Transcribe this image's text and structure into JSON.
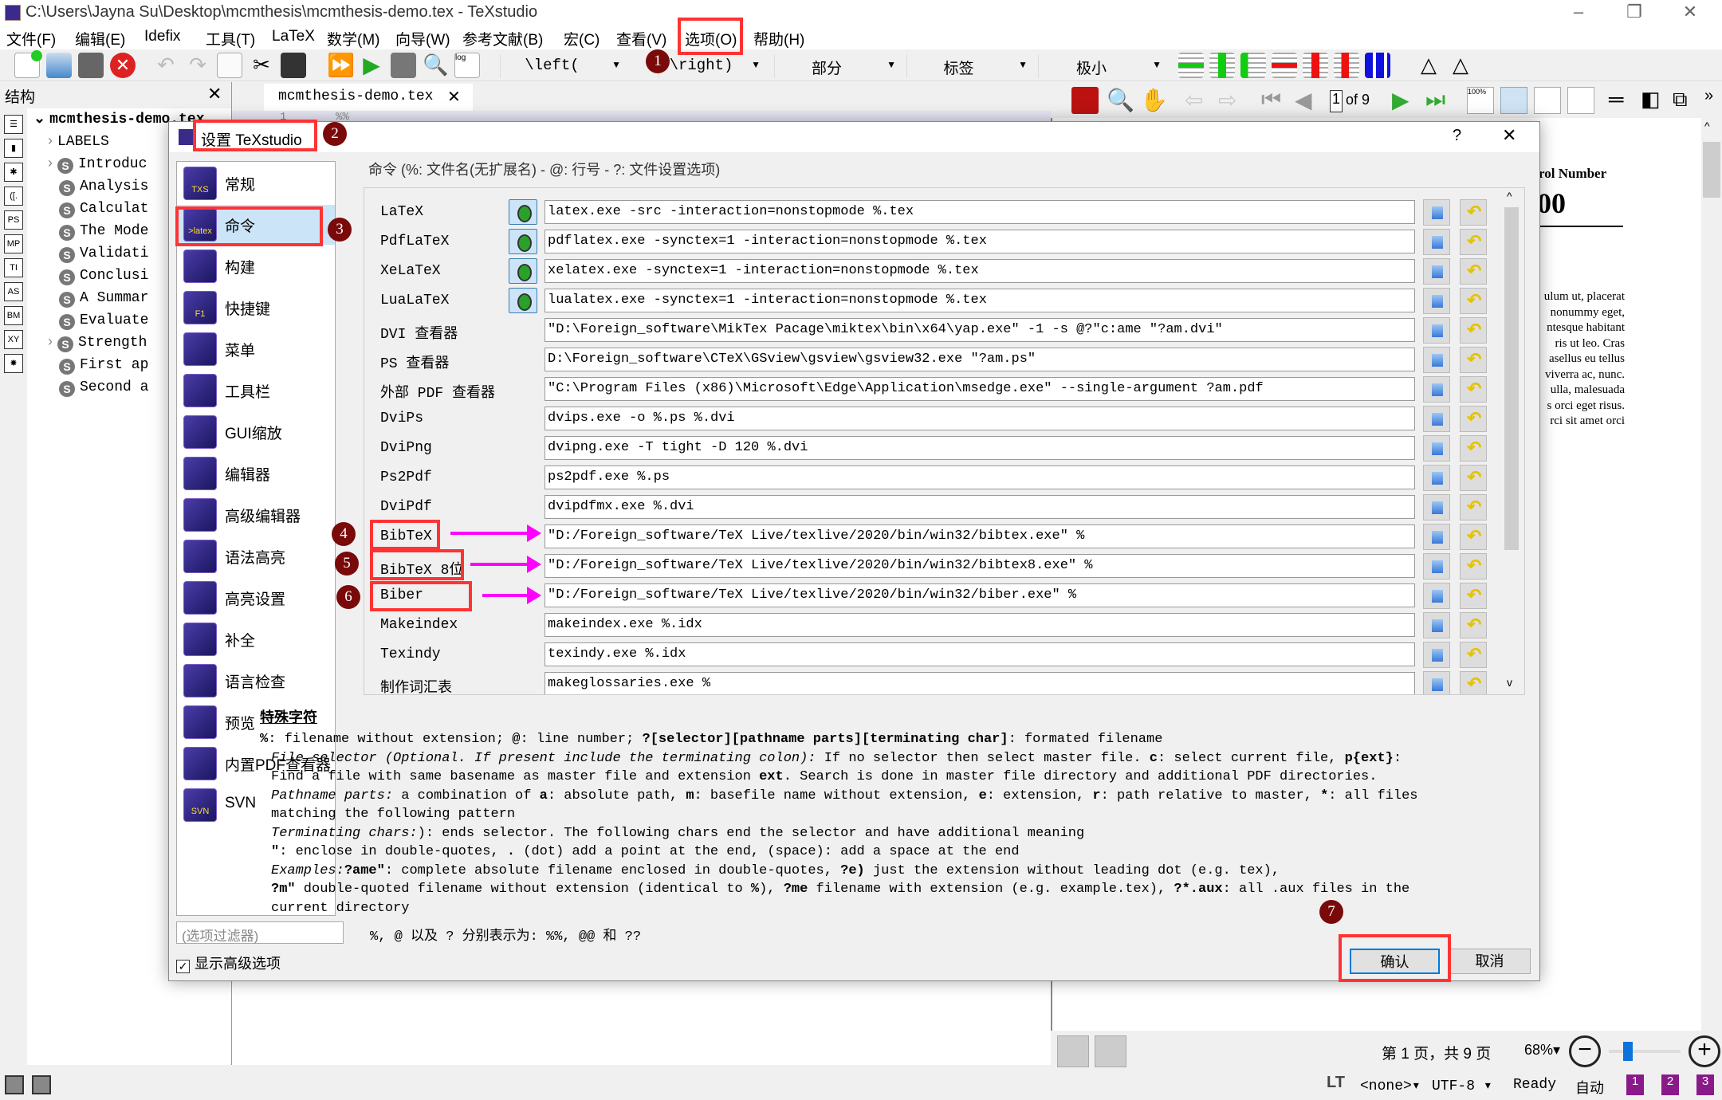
{
  "window": {
    "title": "C:\\Users\\Jayna Su\\Desktop\\mcmthesis\\mcmthesis-demo.tex - TeXstudio",
    "controls": [
      "–",
      "❐",
      "✕"
    ]
  },
  "menu": [
    "文件(F)",
    "编辑(E)",
    "Idefix",
    "工具(T)",
    "LaTeX",
    "数学(M)",
    "向导(W)",
    "参考文献(B)",
    "宏(C)",
    "查看(V)",
    "选项(O)",
    "帮助(H)"
  ],
  "toolbar": {
    "dropdowns": [
      "\\left(",
      "\\right)",
      "部分",
      "标签",
      "极小"
    ]
  },
  "structure": {
    "title": "结构",
    "root": "mcmthesis-demo.tex",
    "items": [
      {
        "label": "LABELS",
        "expandable": true,
        "badge": false
      },
      {
        "label": "Introduc",
        "expandable": true,
        "badge": true
      },
      {
        "label": "Analysis",
        "expandable": false,
        "badge": true
      },
      {
        "label": "Calculat",
        "expandable": false,
        "badge": true
      },
      {
        "label": "The Mode",
        "expandable": false,
        "badge": true
      },
      {
        "label": "Validati",
        "expandable": false,
        "badge": true
      },
      {
        "label": "Conclusi",
        "expandable": false,
        "badge": true
      },
      {
        "label": "A Summar",
        "expandable": false,
        "badge": true
      },
      {
        "label": "Evaluate",
        "expandable": false,
        "badge": true
      },
      {
        "label": "Strength",
        "expandable": true,
        "badge": true
      },
      {
        "label": "First ap",
        "expandable": false,
        "badge": true
      },
      {
        "label": "Second a",
        "expandable": false,
        "badge": true
      }
    ],
    "side_icons": [
      "☰",
      "▮",
      "✱",
      "([.",
      "PS",
      "MP",
      "TI",
      "AS",
      "BM",
      "XY",
      "✸"
    ]
  },
  "editor": {
    "tab": "mcmthesis-demo.tex",
    "line_number": "1",
    "line_text": "%%"
  },
  "pdf": {
    "page_input": "1",
    "page_of": "of 9",
    "heading": "rol Number",
    "big": "00",
    "body_lines": [
      "ulum ut, placerat",
      "nonummy eget,",
      "ntesque habitant",
      "ris ut leo.  Cras",
      "asellus eu tellus",
      "viverra ac, nunc.",
      "ulla, malesuada",
      "s orci eget risus.",
      "rci sit amet orci"
    ],
    "page_status": "第 1 页，共 9 页",
    "zoom": "68%",
    "zoom_slider": 0.2
  },
  "statusbar": {
    "lt": "LT",
    "language": "<none>",
    "encoding": "UTF-8",
    "status": "Ready",
    "auto": "自动",
    "bookmarks": [
      "1",
      "2",
      "3"
    ]
  },
  "dialog": {
    "title": "设置 TeXstudio",
    "help": "?",
    "close": "✕",
    "nav": [
      "常规",
      "命令",
      "构建",
      "快捷键",
      "菜单",
      "工具栏",
      "GUI缩放",
      "编辑器",
      "高级编辑器",
      "语法高亮",
      "高亮设置",
      "补全",
      "语言检查",
      "预览",
      "内置PDF查看器",
      "SVN"
    ],
    "nav_icon_text": [
      "TXS",
      ">latex",
      "",
      "F1",
      "",
      "",
      "",
      "",
      "",
      "",
      "",
      "",
      "",
      "",
      "",
      "SVN"
    ],
    "selected_nav": 1,
    "filter_placeholder": "(选项过滤器)",
    "advanced_label": "显示高级选项",
    "advanced_checked": true,
    "group_title": "命令 (%: 文件名(无扩展名) - @: 行号 - ?: 文件设置选项)",
    "commands": [
      {
        "label": "LaTeX",
        "value": "latex.exe -src -interaction=nonstopmode %.tex",
        "run": true
      },
      {
        "label": "PdfLaTeX",
        "value": "pdflatex.exe -synctex=1 -interaction=nonstopmode %.tex",
        "run": true
      },
      {
        "label": "XeLaTeX",
        "value": "xelatex.exe -synctex=1 -interaction=nonstopmode %.tex",
        "run": true
      },
      {
        "label": "LuaLaTeX",
        "value": "lualatex.exe -synctex=1 -interaction=nonstopmode %.tex",
        "run": true
      },
      {
        "label": "DVI 查看器",
        "value": "\"D:\\Foreign_software\\MikTex Pacage\\miktex\\bin\\x64\\yap.exe\" -1 -s @?\"c:ame \"?am.dvi\"",
        "run": false
      },
      {
        "label": "PS 查看器",
        "value": "D:\\Foreign_software\\CTeX\\GSview\\gsview\\gsview32.exe \"?am.ps\"",
        "run": false
      },
      {
        "label": "外部 PDF 查看器",
        "value": "\"C:\\Program Files (x86)\\Microsoft\\Edge\\Application\\msedge.exe\" --single-argument ?am.pdf",
        "run": false
      },
      {
        "label": "DviPs",
        "value": "dvips.exe -o %.ps %.dvi",
        "run": false
      },
      {
        "label": "DviPng",
        "value": "dvipng.exe -T tight -D 120 %.dvi",
        "run": false
      },
      {
        "label": "Ps2Pdf",
        "value": "ps2pdf.exe %.ps",
        "run": false
      },
      {
        "label": "DviPdf",
        "value": "dvipdfmx.exe %.dvi",
        "run": false
      },
      {
        "label": "BibTeX",
        "value": "\"D:/Foreign_software/TeX Live/texlive/2020/bin/win32/bibtex.exe\" %",
        "run": false
      },
      {
        "label": "BibTeX 8位",
        "value": "\"D:/Foreign_software/TeX Live/texlive/2020/bin/win32/bibtex8.exe\" %",
        "run": false
      },
      {
        "label": "Biber",
        "value": "\"D:/Foreign_software/TeX Live/texlive/2020/bin/win32/biber.exe\" %",
        "run": false
      },
      {
        "label": "Makeindex",
        "value": "makeindex.exe %.idx",
        "run": false
      },
      {
        "label": "Texindy",
        "value": "texindy.exe %.idx",
        "run": false
      },
      {
        "label": "制作词汇表",
        "value": "makeglossaries.exe %",
        "run": false
      }
    ],
    "special_title": "特殊字符",
    "help_lines": [
      "<b>%</b>: filename without extension; <b>@</b>: line number; <b>?[selector][pathname parts][terminating char]</b>: formated filename",
      "<i>File selector (Optional. If present include the terminating colon):</i> If no selector then select master file. <b>c</b>: select current file, <b>p{ext}</b>:",
      "Find a file with same basename as master file and extension <b>ext</b>. Search is done in master file directory and additional PDF directories.",
      "<i>Pathname parts:</i> a combination of <b>a</b>: absolute path, <b>m</b>: basefile name without extension, <b>e</b>: extension, <b>r</b>: path relative to master, <b>*</b>: all files",
      "matching the following pattern",
      "<i>Terminating chars:</i>): ends selector. The following chars end the selector and have additional meaning",
      "<b>\"</b>: enclose in double-quotes, <b>.</b> (dot) add a point at the end, (space): add a space at the end",
      "<i>Examples:</i><b>?ame\"</b>: complete absolute filename enclosed in double-quotes, <b>?e)</b> just the extension without leading dot (e.g. tex),",
      "<b>?m\"</b> double-quoted filename without extension (identical to <b>%</b>), <b>?me</b> filename with extension (e.g. example.tex), <b>?*.aux</b>: all .aux files in the",
      "current directory"
    ],
    "escape_line": "%, @ 以及 ? 分别表示为: %%, @@ 和 ??",
    "ok": "确认",
    "cancel": "取消"
  },
  "annotations": {
    "numbers": [
      "1",
      "2",
      "3",
      "4",
      "5",
      "6",
      "7"
    ],
    "box_color": "#ff3333",
    "arrow_color": "#ff00ff",
    "badge_color": "#7a0a0a"
  }
}
